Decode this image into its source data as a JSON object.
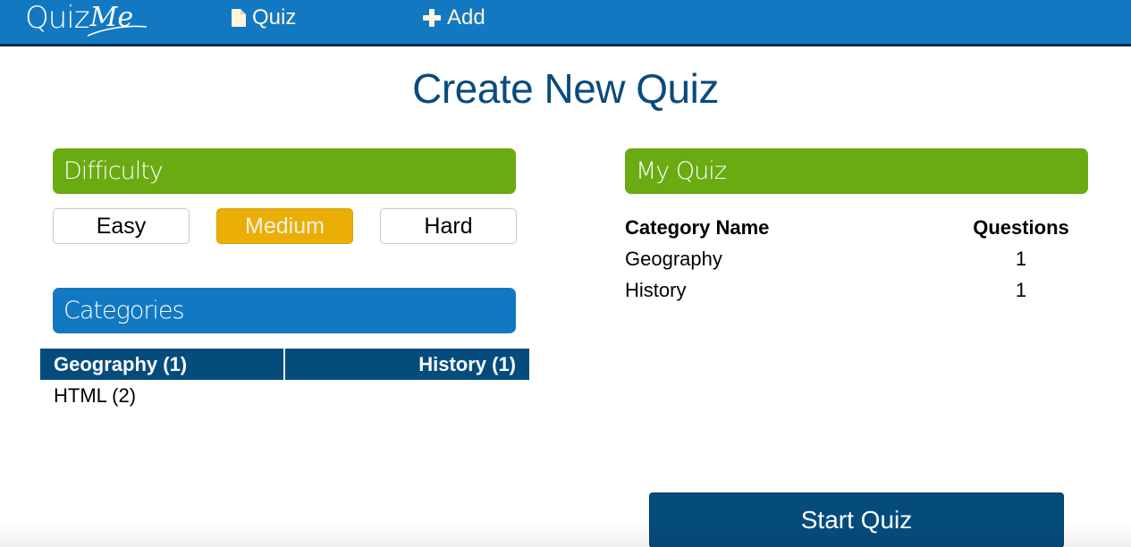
{
  "navbar": {
    "logo": {
      "part1": "Quiz",
      "part2": "Me"
    },
    "items": [
      {
        "label": "Quiz",
        "icon": "file-icon"
      },
      {
        "label": "Add",
        "icon": "plus-icon"
      }
    ]
  },
  "page": {
    "title": "Create New Quiz"
  },
  "difficulty": {
    "header": "Difficulty",
    "options": [
      "Easy",
      "Medium",
      "Hard"
    ],
    "selected": "Medium"
  },
  "categories": {
    "header": "Categories",
    "rows": [
      [
        {
          "label": "Geography (1)",
          "selected": true
        },
        {
          "label": "History (1)",
          "selected": true
        }
      ],
      [
        {
          "label": "HTML (2)",
          "selected": false
        }
      ]
    ]
  },
  "my_quiz": {
    "header": "My Quiz",
    "columns": [
      "Category Name",
      "Questions"
    ],
    "rows": [
      {
        "category": "Geography",
        "questions": "1"
      },
      {
        "category": "History",
        "questions": "1"
      }
    ]
  },
  "actions": {
    "start_label": "Start Quiz"
  },
  "colors": {
    "nav_blue": "#1278c2",
    "nav_border": "#062b4c",
    "green": "#6aab11",
    "selected_orange": "#ebae06",
    "dark_blue": "#054c7d",
    "title_blue": "#094b7e"
  }
}
